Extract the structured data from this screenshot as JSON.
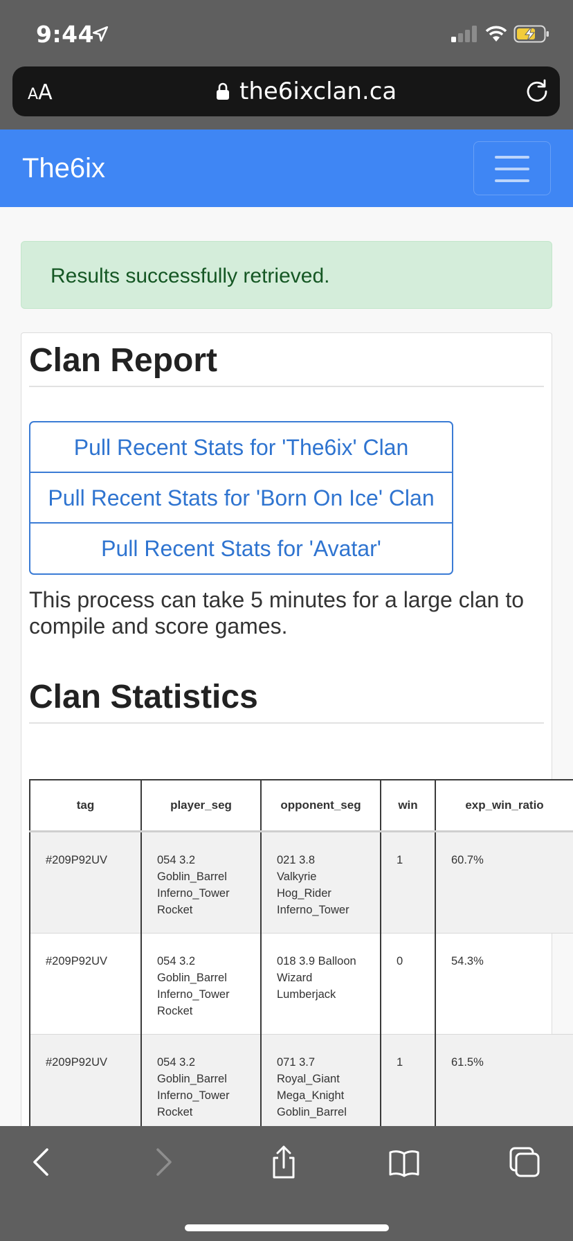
{
  "status_bar": {
    "time": "9:44",
    "icons": [
      "location-arrow-icon",
      "cellular-signal-icon",
      "wifi-icon",
      "battery-charging-icon"
    ]
  },
  "browser": {
    "text_size_label_small": "A",
    "text_size_label_large": "A",
    "url": "the6ixclan.ca"
  },
  "navbar": {
    "brand": "The6ix"
  },
  "alert": {
    "message": "Results successfully retrieved."
  },
  "report": {
    "title": "Clan Report",
    "buttons": [
      "Pull Recent Stats for 'The6ix' Clan",
      "Pull Recent Stats for 'Born On Ice' Clan",
      "Pull Recent Stats for 'Avatar'"
    ],
    "note": "This process can take 5 minutes for a large clan to compile and score games."
  },
  "stats": {
    "title": "Clan Statistics",
    "columns": [
      "tag",
      "player_seg",
      "opponent_seg",
      "win",
      "exp_win_ratio"
    ],
    "rows": [
      {
        "tag": "#209P92UV",
        "player_seg": [
          "054 3.2",
          "Goblin_Barrel",
          "Inferno_Tower",
          "Rocket"
        ],
        "opponent_seg": [
          "021 3.8",
          "Valkyrie",
          "Hog_Rider",
          "Inferno_Tower"
        ],
        "win": "1",
        "exp_win_ratio": "60.7%"
      },
      {
        "tag": "#209P92UV",
        "player_seg": [
          "054 3.2",
          "Goblin_Barrel",
          "Inferno_Tower",
          "Rocket"
        ],
        "opponent_seg": [
          "018 3.9 Balloon",
          "Wizard",
          "Lumberjack"
        ],
        "win": "0",
        "exp_win_ratio": "54.3%"
      },
      {
        "tag": "#209P92UV",
        "player_seg": [
          "054 3.2",
          "Goblin_Barrel",
          "Inferno_Tower",
          "Rocket"
        ],
        "opponent_seg": [
          "071 3.7",
          "Royal_Giant",
          "Mega_Knight",
          "Goblin_Barrel"
        ],
        "win": "1",
        "exp_win_ratio": "61.5%"
      }
    ]
  },
  "colors": {
    "navbar": "#3f86f4",
    "alert_bg": "#d4edda",
    "alert_text": "#155724",
    "button_outline": "#3a7bd5",
    "chrome": "#5f5f5f"
  }
}
